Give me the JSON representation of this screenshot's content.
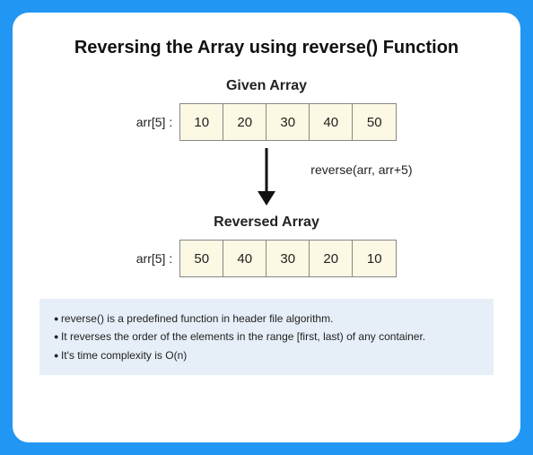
{
  "title": "Reversing the Array using reverse() Function",
  "given": {
    "heading": "Given Array",
    "label": "arr[5] :",
    "cells": [
      "10",
      "20",
      "30",
      "40",
      "50"
    ]
  },
  "operation": "reverse(arr, arr+5)",
  "reversed": {
    "heading": "Reversed Array",
    "label": "arr[5] :",
    "cells": [
      "50",
      "40",
      "30",
      "20",
      "10"
    ]
  },
  "notes": [
    "reverse() is a predefined function in header file algorithm.",
    "It reverses the order of the elements in the range [first, last) of any container.",
    "It's time complexity is O(n)"
  ]
}
